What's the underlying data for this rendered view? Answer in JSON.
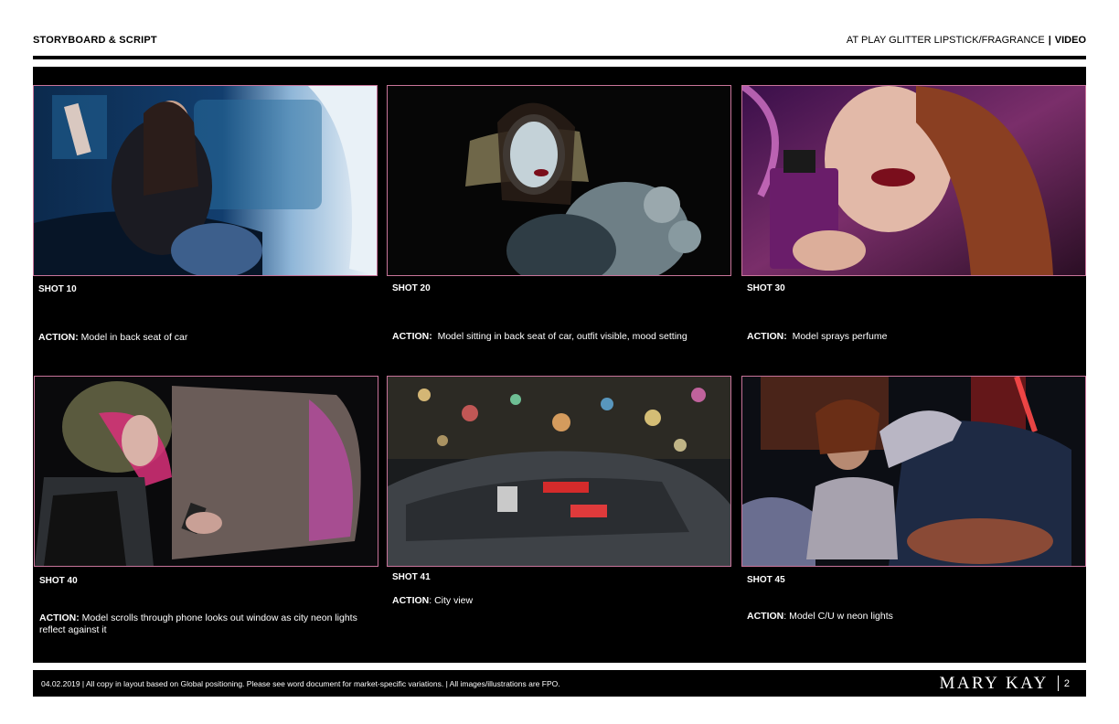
{
  "header": {
    "left": "STORYBOARD & SCRIPT",
    "right_title": "AT PLAY GLITTER LIPSTICK/FRAGRANCE",
    "divider": "|",
    "right_type": "VIDEO"
  },
  "shots": [
    {
      "label": "SHOT 10",
      "action_label": "ACTION:",
      "action_text": "Model in back seat of car",
      "image": "model-in-car-window-photo"
    },
    {
      "label": "SHOT 20",
      "action_label": "ACTION:",
      "action_text": "Model sitting in back seat of car, outfit visible, mood setting",
      "image": "model-red-lips-car-photo"
    },
    {
      "label": "SHOT 30",
      "action_label": "ACTION:",
      "action_text": "Model sprays perfume",
      "image": "model-perfume-bottle-photo"
    },
    {
      "label": "SHOT 40",
      "action_label": "ACTION:",
      "action_text": "Model scrolls through phone looks out window as city neon lights reflect against it",
      "image": "model-phone-neon-photo"
    },
    {
      "label": "SHOT 41",
      "action_label": "ACTION",
      "action_text": ": City view",
      "image": "city-bokeh-lights-photo"
    },
    {
      "label": "SHOT 45",
      "action_label": "ACTION",
      "action_text": ": Model C/U w neon lights",
      "image": "model-neon-closeup-photo"
    }
  ],
  "footer": {
    "note": "04.02.2019  |  All copy in layout based on Global positioning. Please see word document for market-specific variations.  |  All images/illustrations are FPO.",
    "logo": "MARY KAY",
    "page": "2"
  }
}
